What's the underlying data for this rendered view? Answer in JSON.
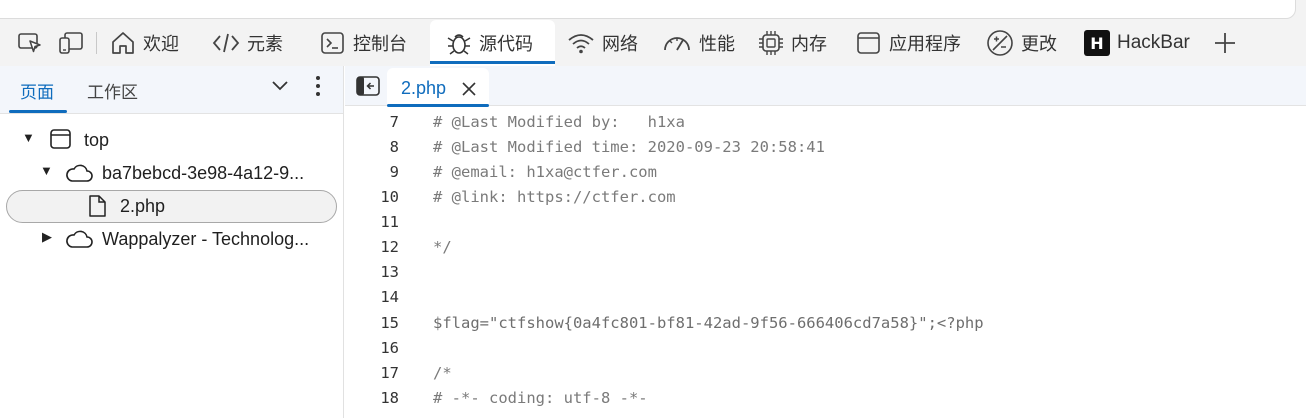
{
  "toolbar": {
    "tabs": [
      {
        "label": "欢迎",
        "icon": "home-icon"
      },
      {
        "label": "元素",
        "icon": "code-brackets-icon"
      },
      {
        "label": "控制台",
        "icon": "console-icon"
      },
      {
        "label": "源代码",
        "icon": "bug-icon",
        "active": true
      },
      {
        "label": "网络",
        "icon": "wifi-icon"
      },
      {
        "label": "性能",
        "icon": "gauge-icon"
      },
      {
        "label": "内存",
        "icon": "chip-icon"
      },
      {
        "label": "应用程序",
        "icon": "window-icon"
      },
      {
        "label": "更改",
        "icon": "diff-icon"
      },
      {
        "label": "HackBar",
        "icon": "hackbar-icon",
        "badge": "H"
      }
    ],
    "add_icon": "plus-icon"
  },
  "left_panel": {
    "tabs": [
      {
        "label": "页面",
        "active": true
      },
      {
        "label": "工作区"
      }
    ],
    "tree": [
      {
        "label": "top",
        "expanded": true,
        "icon": "frame-icon",
        "level": 0
      },
      {
        "label": "ba7bebcd-3e98-4a12-9...",
        "expanded": true,
        "icon": "cloud-icon",
        "level": 1
      },
      {
        "label": "2.php",
        "icon": "file-icon",
        "level": 2,
        "selected": true
      },
      {
        "label": "Wappalyzer - Technolog...",
        "expanded": false,
        "icon": "cloud-icon",
        "level": 1
      }
    ]
  },
  "editor": {
    "open_file": "2.php",
    "lines": [
      {
        "n": "7",
        "text": "# @Last Modified by:   h1xa"
      },
      {
        "n": "8",
        "text": "# @Last Modified time: 2020-09-23 20:58:41"
      },
      {
        "n": "9",
        "text": "# @email: h1xa@ctfer.com"
      },
      {
        "n": "10",
        "text": "# @link: https://ctfer.com"
      },
      {
        "n": "11",
        "text": ""
      },
      {
        "n": "12",
        "text": "*/"
      },
      {
        "n": "13",
        "text": ""
      },
      {
        "n": "14",
        "text": ""
      },
      {
        "n": "15",
        "text": "$flag=\"ctfshow{0a4fc801-bf81-42ad-9f56-666406cd7a58}\";<?php"
      },
      {
        "n": "16",
        "text": ""
      },
      {
        "n": "17",
        "text": "/*"
      },
      {
        "n": "18",
        "text": "# -*- coding: utf-8 -*-"
      }
    ]
  },
  "colors": {
    "accent": "#0f6cbd",
    "toolbar_bg": "#f3f3f3",
    "panel_header_bg": "#f3f6fb",
    "code_text": "#7a7a7a"
  }
}
